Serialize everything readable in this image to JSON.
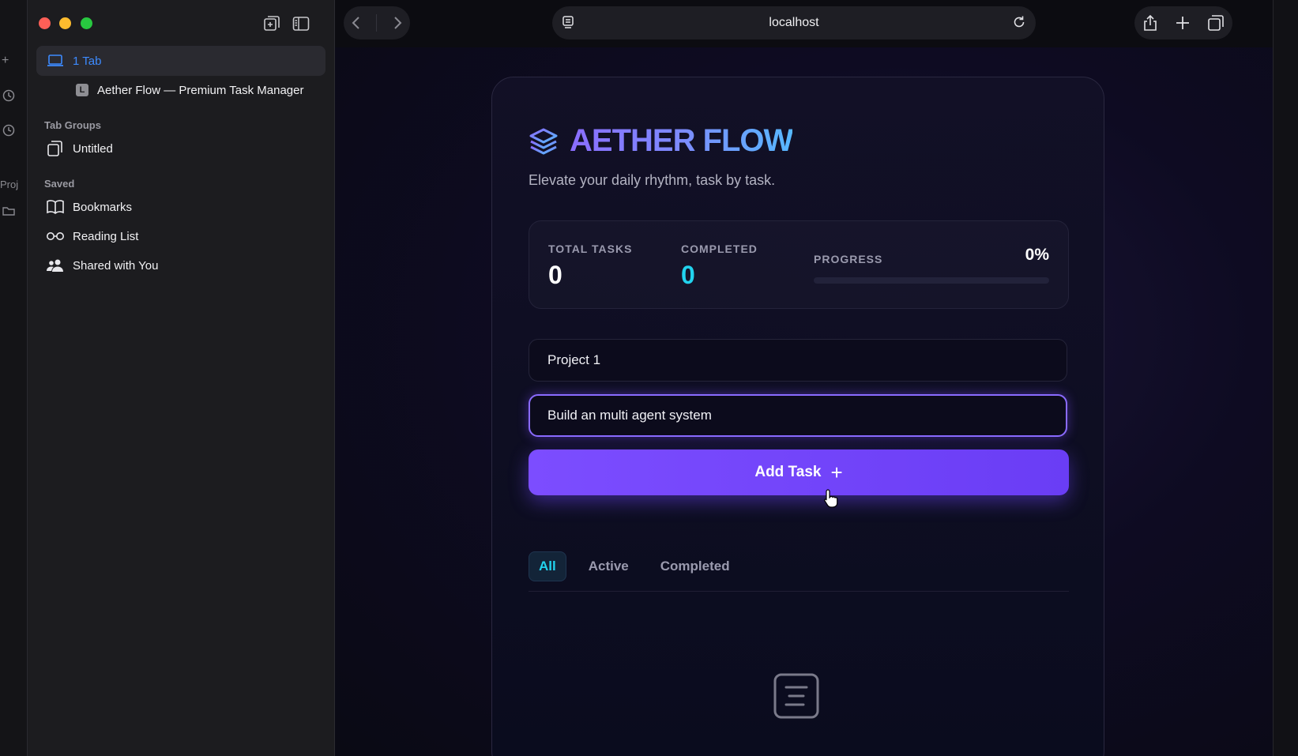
{
  "edge": {
    "partial_label": "Proj"
  },
  "sidebar": {
    "tabs_row_label": "1 Tab",
    "open_tab": {
      "favicon_letter": "L",
      "title": "Aether Flow — Premium Task Manager"
    },
    "tab_groups_heading": "Tab Groups",
    "tab_group_untitled": "Untitled",
    "saved_heading": "Saved",
    "saved_items": [
      {
        "label": "Bookmarks",
        "icon": "book-icon"
      },
      {
        "label": "Reading List",
        "icon": "glasses-icon"
      },
      {
        "label": "Shared with You",
        "icon": "people-icon"
      }
    ]
  },
  "toolbar": {
    "url": "localhost"
  },
  "app": {
    "title": "AETHER FLOW",
    "tagline": "Elevate your daily rhythm, task by task.",
    "stats": {
      "total_label": "TOTAL TASKS",
      "total_value": "0",
      "completed_label": "COMPLETED",
      "completed_value": "0",
      "progress_label": "PROGRESS",
      "progress_text": "0%",
      "progress_fraction": 0
    },
    "project_value": "Project 1",
    "task_value": "Build an multi agent system",
    "add_button_label": "Add Task",
    "add_button_glyph": "+",
    "filters": [
      "All",
      "Active",
      "Completed"
    ],
    "active_filter": "All"
  },
  "colors": {
    "accent_purple": "#7c4dff",
    "accent_cyan": "#22d3ee",
    "link_blue": "#3d8bff"
  }
}
